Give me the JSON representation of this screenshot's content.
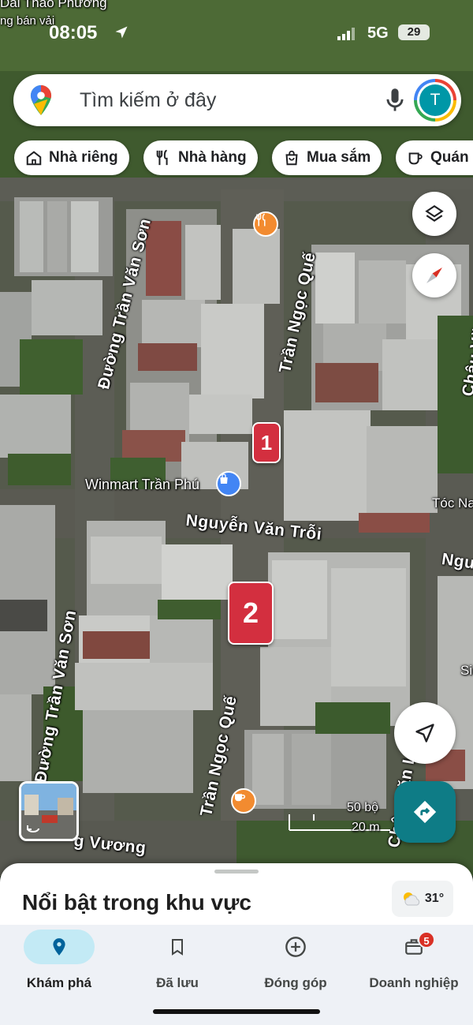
{
  "status_bar": {
    "top_label_1": "Dai Thảo Phường",
    "top_label_2": "ng bán vải",
    "time": "08:05",
    "network": "5G",
    "battery": "29"
  },
  "search": {
    "placeholder": "Tìm kiếm ở đây",
    "avatar_initial": "T"
  },
  "chips": [
    {
      "label": "Nhà riêng",
      "icon": "home-icon"
    },
    {
      "label": "Nhà hàng",
      "icon": "restaurant-icon"
    },
    {
      "label": "Mua sắm",
      "icon": "shopping-bag-icon"
    },
    {
      "label": "Quán",
      "icon": "coffee-icon"
    }
  ],
  "map": {
    "streets": [
      "Đường Trần Văn Sơn",
      "Trần Ngọc Quế",
      "Châu Văn",
      "Nguyễn Văn Trỗi",
      "Ngu",
      "Đường Trần Văn Sơn",
      "Trần Ngọc Quế",
      "Châu Văn L",
      "g Vương"
    ],
    "places": [
      "Winmart Trần Phú",
      "Tóc Na",
      "Si"
    ],
    "markers": [
      "1",
      "2"
    ],
    "scale": {
      "imperial": "50 bộ",
      "metric": "20 m"
    }
  },
  "sheet": {
    "title": "Nổi bật trong khu vực",
    "temperature": "31°"
  },
  "nav": [
    {
      "label": "Khám phá",
      "icon": "explore-pin-icon",
      "active": true
    },
    {
      "label": "Đã lưu",
      "icon": "bookmark-icon",
      "active": false
    },
    {
      "label": "Đóng góp",
      "icon": "add-circle-icon",
      "active": false
    },
    {
      "label": "Doanh nghiệp",
      "icon": "business-icon",
      "active": false,
      "badge": "5"
    }
  ],
  "colors": {
    "marker_red": "#d32f3f",
    "route_teal": "#0e7c86",
    "active_nav": "#c3eaf5",
    "food_poi": "#f28b30"
  }
}
